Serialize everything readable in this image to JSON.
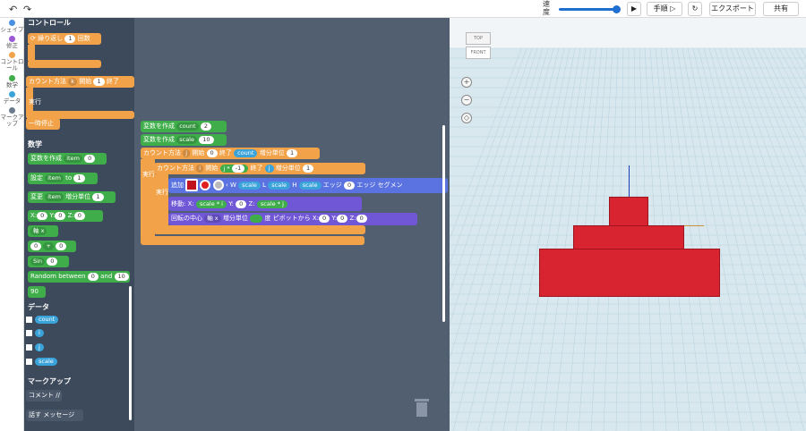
{
  "topbar": {
    "speed": "速度",
    "step": "手順",
    "export": "エクスポート",
    "share": "共有"
  },
  "categories": [
    {
      "name": "シェイプ",
      "color": "#4a90e2"
    },
    {
      "name": "修正",
      "color": "#9b59d6"
    },
    {
      "name": "コントロール",
      "color": "#f2a34a"
    },
    {
      "name": "数学",
      "color": "#3fae4a"
    },
    {
      "name": "データ",
      "color": "#3aa3d9"
    },
    {
      "name": "マークアップ",
      "color": "#6b7b8c"
    }
  ],
  "flyout": {
    "control_title": "コントロール",
    "repeat": "繰り返し",
    "repeat_n": "1",
    "times": "回数",
    "count_with": "カウント方法",
    "var_k": "k",
    "start": "開始",
    "start_n": "1",
    "end": "終了",
    "do": "実行",
    "pause": "一時停止",
    "math_title": "数学",
    "create_var": "変数を作成",
    "item": "item",
    "zero": "0",
    "set": "設定",
    "to": "to",
    "set_n": "1",
    "change": "変更",
    "increment": "増分単位",
    "change_n": "1",
    "x": "X:",
    "y": "Y:",
    "z": "Z:",
    "xv": "0",
    "yv": "0",
    "zv": "0",
    "axis": "軸 x",
    "plus": "+",
    "op_a": "0",
    "op_b": "0",
    "sin": "Sin",
    "sin_v": "0",
    "random": "Random between",
    "rand_a": "0",
    "and": "and",
    "rand_b": "10",
    "ninety": "90",
    "data_title": "データ",
    "vars": [
      "count",
      "i",
      "j",
      "scale"
    ],
    "markup_title": "マークアップ",
    "comment": "コメント //",
    "say": "話す",
    "message": "メッセージ"
  },
  "workspace": {
    "b1_label": "変数を作成",
    "b1_var": "count",
    "b1_val": "2",
    "b2_label": "変数を作成",
    "b2_var": "scale",
    "b2_val": "10",
    "b3_label": "カウント方法",
    "b3_var": "j",
    "b3_start": "開始",
    "b3_s": "0",
    "b3_end": "終了",
    "b3_e": "count",
    "b3_inc": "増分単位",
    "b3_i": "1",
    "b4_label": "カウント方法",
    "b4_var": "i",
    "b4_start": "開始",
    "b4_j": "j",
    "b4_op": "*",
    "b4_neg": "-1",
    "b4_end": "終了",
    "b4_ej": "j",
    "b4_inc": "増分単位",
    "b4_i": "1",
    "do1": "実行",
    "do2": "実行",
    "add": "追加",
    "w": "W",
    "scale": "scale",
    "l": "L",
    "h": "H",
    "edge": "エッジ",
    "edge_v": "0",
    "edge_seg": "エッジ セグメン",
    "move": "移動:",
    "mx": "X:",
    "my": "Y:",
    "mz": "Z:",
    "m_op": "*",
    "mi": "i",
    "my_v": "0",
    "mj": "j",
    "rot": "回転の中心",
    "rot_axis": "軸 x",
    "rot_inc": "増分単位",
    "rot_deg": "度",
    "pivot": "ピボットから",
    "rx": "X:",
    "rxv": "0",
    "ry": "Y:",
    "ryv": "0",
    "rz": "Z:",
    "rzv": "0",
    "view_minus": "−",
    "view_plus": "+",
    "view_eq": "="
  },
  "viewport": {
    "top": "TOP",
    "front": "FRONT"
  }
}
